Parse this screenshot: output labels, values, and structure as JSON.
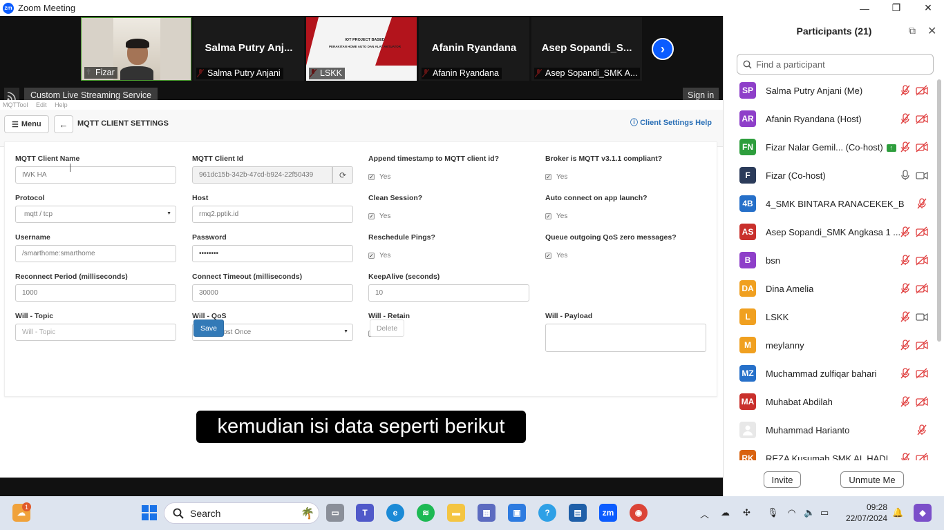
{
  "window": {
    "title": "Zoom Meeting"
  },
  "videos": [
    {
      "name": "",
      "label": "Fizar"
    },
    {
      "name": "Salma Putry Anj...",
      "label": "Salma Putry Anjani"
    },
    {
      "name": "",
      "label": "LSKK",
      "slide_title": "IOT PROJECT BASED",
      "slide_subtitle": "PERAKITAN HOME AUTO DAN ALAT AKTUATOR"
    },
    {
      "name": "Afanin Ryandana",
      "label": "Afanin Ryandana"
    },
    {
      "name": "Asep Sopandi_S...",
      "label": "Asep Sopandi_SMK A..."
    }
  ],
  "livestream": {
    "label": "Custom Live Streaming Service",
    "signin": "Sign in"
  },
  "share": {
    "menubar": [
      "MQTTool",
      "Edit",
      "Help"
    ],
    "menu_label": "Menu",
    "heading": "MQTT CLIENT SETTINGS",
    "help": "Client Settings Help",
    "fields": {
      "client_name": {
        "label": "MQTT Client Name",
        "value": "IWK HA"
      },
      "client_id": {
        "label": "MQTT Client Id",
        "value": "961dc15b-342b-47cd-b924-22f50439"
      },
      "append_ts": {
        "label": "Append timestamp to MQTT client id?",
        "value": "Yes"
      },
      "broker_compliant": {
        "label": "Broker is MQTT v3.1.1 compliant?",
        "value": "Yes"
      },
      "protocol": {
        "label": "Protocol",
        "value": "mqtt / tcp"
      },
      "host": {
        "label": "Host",
        "value": "rmq2.pptik.id"
      },
      "clean_session": {
        "label": "Clean Session?",
        "value": "Yes"
      },
      "auto_connect": {
        "label": "Auto connect on app launch?",
        "value": "Yes"
      },
      "username": {
        "label": "Username",
        "value": "/smarthome:smarthome"
      },
      "password": {
        "label": "Password",
        "value": "••••••••"
      },
      "reschedule": {
        "label": "Reschedule Pings?",
        "value": "Yes"
      },
      "queue_qos": {
        "label": "Queue outgoing QoS zero messages?",
        "value": "Yes"
      },
      "reconnect": {
        "label": "Reconnect Period (milliseconds)",
        "value": "1000"
      },
      "timeout": {
        "label": "Connect Timeout (milliseconds)",
        "value": "30000"
      },
      "keepalive": {
        "label": "KeepAlive (seconds)",
        "value": "10"
      },
      "will_topic": {
        "label": "Will - Topic",
        "placeholder": "Will - Topic"
      },
      "will_qos": {
        "label": "Will - QoS",
        "value": "0 - Almost Once"
      },
      "will_retain": {
        "label": "Will - Retain",
        "value": "No"
      },
      "will_payload": {
        "label": "Will - Payload"
      }
    },
    "save": "Save",
    "delete": "Delete",
    "caption": "kemudian isi data seperti berikut"
  },
  "participants": {
    "title": "Participants (21)",
    "search_placeholder": "Find a participant",
    "items": [
      {
        "initials": "SP",
        "name": "Salma Putry Anjani (Me)",
        "color": "#8e3fc9",
        "cam": "off"
      },
      {
        "initials": "AR",
        "name": "Afanin Ryandana (Host)",
        "color": "#8e3fc9",
        "cam": "off"
      },
      {
        "initials": "FN",
        "name": "Fizar Nalar Gemil... (Co-host)",
        "color": "#2e9e3d",
        "cam": "off",
        "sharing": true
      },
      {
        "initials": "F",
        "name": "Fizar (Co-host)",
        "color": "#2b3b5a",
        "mic": "on",
        "cam": "on"
      },
      {
        "initials": "4B",
        "name": "4_SMK BINTARA RANACEKEK_BAN...",
        "color": "#2670c9",
        "cam": "none"
      },
      {
        "initials": "AS",
        "name": "Asep Sopandi_SMK Angkasa 1 ...",
        "color": "#c9302c",
        "cam": "off"
      },
      {
        "initials": "B",
        "name": "bsn",
        "color": "#8e3fc9",
        "cam": "off"
      },
      {
        "initials": "DA",
        "name": "Dina Amelia",
        "color": "#f0a020",
        "cam": "off"
      },
      {
        "initials": "L",
        "name": "LSKK",
        "color": "#f0a020",
        "cam": "on"
      },
      {
        "initials": "M",
        "name": "meylanny",
        "color": "#f0a020",
        "cam": "off"
      },
      {
        "initials": "MZ",
        "name": "Muchammad zulfiqar bahari",
        "color": "#2670c9",
        "cam": "off"
      },
      {
        "initials": "MA",
        "name": "Muhabat Abdilah",
        "color": "#c9302c",
        "cam": "off"
      },
      {
        "initials": "",
        "name": "Muhammad Harianto",
        "color": "#e8e8e8",
        "cam": "none"
      },
      {
        "initials": "RK",
        "name": "REZA Kusumah SMK AL HADI",
        "color": "#d9620f",
        "cam": "off"
      }
    ],
    "invite": "Invite",
    "unmute": "Unmute Me"
  },
  "taskbar": {
    "search": "Search",
    "notification_count": "1",
    "time": "09:28",
    "date": "22/07/2024"
  }
}
